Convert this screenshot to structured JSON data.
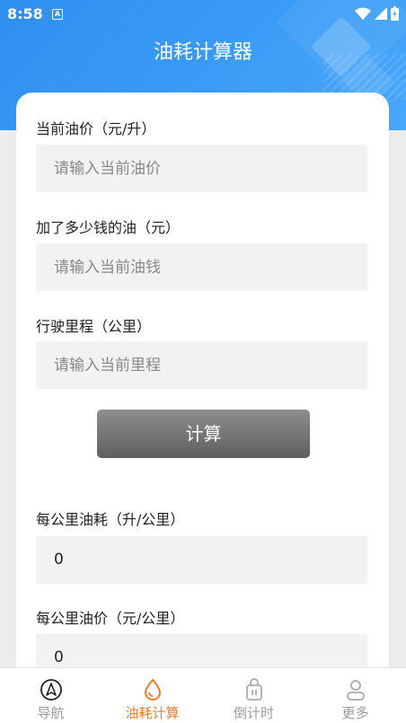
{
  "status_bar": {
    "time": "8:58",
    "a_badge": "A"
  },
  "header": {
    "title": "油耗计算器"
  },
  "form": {
    "price_label": "当前油价（元/升）",
    "price_placeholder": "请输入当前油价",
    "money_label": "加了多少钱的油（元）",
    "money_placeholder": "请输入当前油钱",
    "distance_label": "行驶里程（公里）",
    "distance_placeholder": "请输入当前里程",
    "calc_button": "计算"
  },
  "results": {
    "consumption_label": "每公里油耗（升/公里）",
    "consumption_value": "0",
    "cost_label": "每公里油价（元/公里）",
    "cost_value": "0"
  },
  "tabbar": {
    "items": [
      {
        "label": "导航",
        "icon": "navigation-icon",
        "active": false
      },
      {
        "label": "油耗计算",
        "icon": "fuel-drop-icon",
        "active": true
      },
      {
        "label": "倒计时",
        "icon": "timer-icon",
        "active": false
      },
      {
        "label": "更多",
        "icon": "user-icon",
        "active": false
      }
    ]
  },
  "colors": {
    "header": "#3a9cf6",
    "active_tab": "#f07d2e",
    "inactive_tab": "#9b9b9b"
  }
}
